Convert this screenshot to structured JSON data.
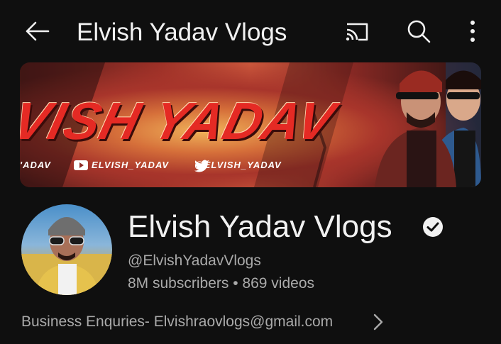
{
  "header": {
    "title": "Elvish Yadav Vlogs",
    "back_icon": "arrow-left-icon",
    "cast_icon": "cast-icon",
    "search_icon": "search-icon",
    "more_icon": "more-vertical-icon"
  },
  "banner": {
    "brand_text": "VISH YADAV",
    "handles": [
      "'ADAV",
      "ELVISH_YADAV",
      "@ELVISH_YADAV"
    ]
  },
  "channel": {
    "name": "Elvish Yadav Vlogs",
    "handle": "@ElvishYadavVlogs",
    "subscribers": "8M subscribers",
    "separator": "•",
    "videos": "869 videos",
    "about": "Business Enquries- Elvishraovlogs@gmail.com"
  },
  "colors": {
    "background": "#0f0f0f",
    "text_primary": "#f1f1f1",
    "text_secondary": "#aaaaaa"
  }
}
